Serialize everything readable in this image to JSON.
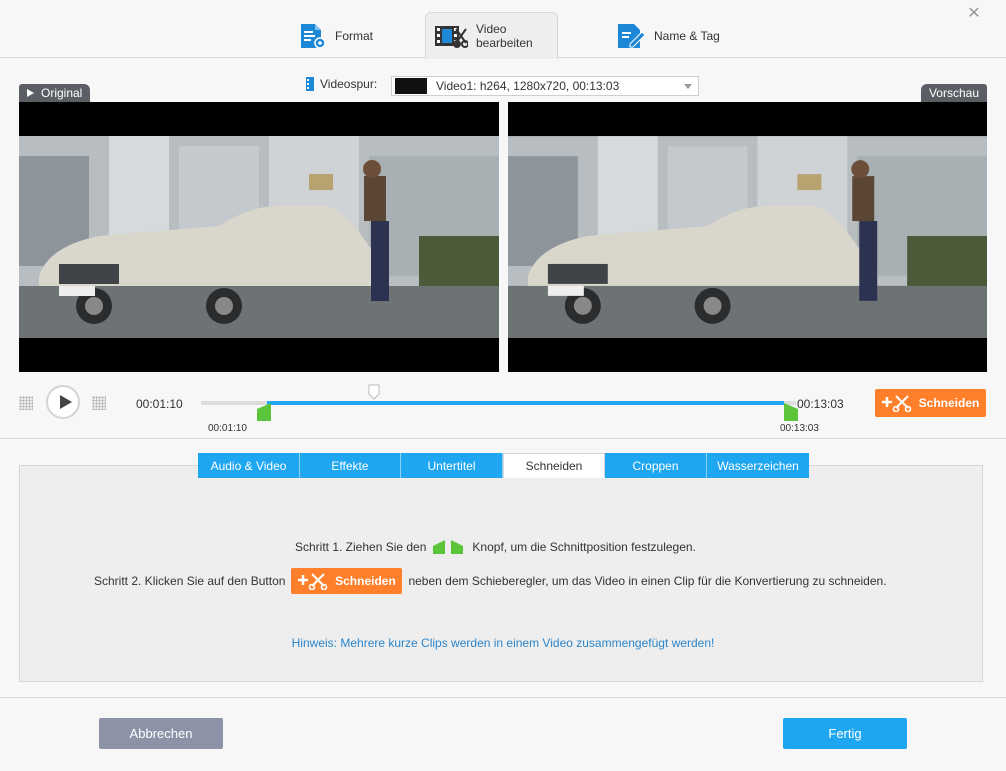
{
  "tabs": [
    {
      "label": "Format",
      "icon": "format-settings-icon"
    },
    {
      "label": "Video bearbeiten",
      "icon": "video-edit-icon",
      "active": true
    },
    {
      "label": "Name & Tag",
      "icon": "name-tag-edit-icon"
    }
  ],
  "preview": {
    "original_label": "Original",
    "preview_label": "Vorschau",
    "track_label": "Videospur:",
    "track_value": "Video1: h264, 1280x720, 00:13:03"
  },
  "playback": {
    "current_time": "00:01:10",
    "end_time": "00:13:03",
    "start_marker_label": "00:01:10",
    "end_marker_label": "00:13:03",
    "playhead_fraction": 0.29,
    "selection_start_fraction": 0.09,
    "selection_end_fraction": 1.0,
    "cut_button": "Schneiden"
  },
  "edit_tabs": [
    {
      "label": "Audio & Video"
    },
    {
      "label": "Effekte"
    },
    {
      "label": "Untertitel"
    },
    {
      "label": "Schneiden",
      "active": true
    },
    {
      "label": "Croppen"
    },
    {
      "label": "Wasserzeichen"
    }
  ],
  "instructions": {
    "step1_before": "Schritt 1. Ziehen Sie den",
    "step1_after": "Knopf, um die Schnittposition festzulegen.",
    "step2_before": "Schritt 2. Klicken Sie auf den Button",
    "step2_button": "Schneiden",
    "step2_after": "neben dem Schieberegler, um das Video in einen Clip für die Konvertierung zu schneiden.",
    "hint": "Hinweis: Mehrere kurze Clips werden in einem Video zusammengefügt werden!"
  },
  "footer": {
    "cancel": "Abbrechen",
    "done": "Fertig"
  },
  "colors": {
    "accent": "#1ea6f0",
    "cut_orange": "#ff7f2a",
    "marker_green": "#5cc43a",
    "cancel_gray": "#8c93a7"
  }
}
